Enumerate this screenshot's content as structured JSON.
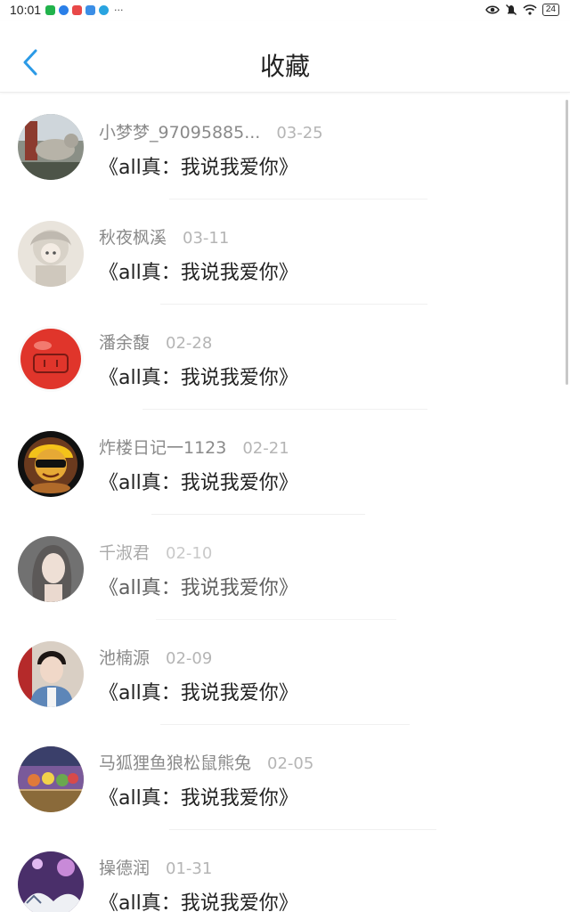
{
  "status_bar": {
    "time": "10:01",
    "more": "···",
    "battery": "24",
    "notif_colors": [
      "#21b34c",
      "#2a7fe8",
      "#e84848",
      "#3b8ee6",
      "#29a4e0"
    ]
  },
  "header": {
    "title": "收藏",
    "back_icon": "chevron-left-icon",
    "accent": "#2b9ae6"
  },
  "favorites": [
    {
      "user": "小梦梦_97095885...",
      "date": "03-25",
      "title": "《all真：我说我爱你》"
    },
    {
      "user": "秋夜枫溪",
      "date": "03-11",
      "title": "《all真：我说我爱你》"
    },
    {
      "user": "潘余馥",
      "date": "02-28",
      "title": "《all真：我说我爱你》"
    },
    {
      "user": "炸楼日记一1123",
      "date": "02-21",
      "title": "《all真：我说我爱你》"
    },
    {
      "user": "千淑君",
      "date": "02-10",
      "title": "《all真：我说我爱你》"
    },
    {
      "user": "池楠源",
      "date": "02-09",
      "title": "《all真：我说我爱你》"
    },
    {
      "user": "马狐狸鱼狼松鼠熊兔",
      "date": "02-05",
      "title": "《all真：我说我爱你》"
    },
    {
      "user": "操德润",
      "date": "01-31",
      "title": "《all真：我说我爱你》"
    }
  ]
}
